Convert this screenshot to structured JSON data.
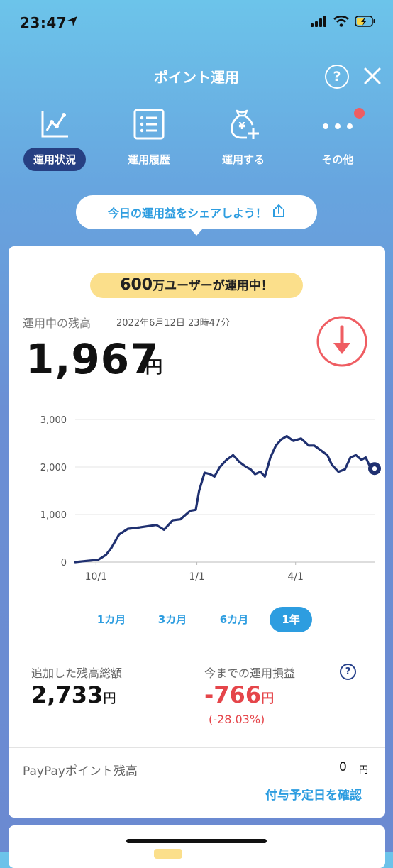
{
  "status_bar": {
    "time": "23:47"
  },
  "header": {
    "title": "ポイント運用",
    "help_label": "?"
  },
  "nav": [
    {
      "label": "運用状況",
      "icon": "line-chart-icon",
      "active": true
    },
    {
      "label": "運用履歴",
      "icon": "list-icon",
      "active": false
    },
    {
      "label": "運用する",
      "icon": "money-bag-add-icon",
      "active": false
    },
    {
      "label": "その他",
      "icon": "more-dots-icon",
      "active": false
    }
  ],
  "share": {
    "text": "今日の運用益をシェアしよう！"
  },
  "card": {
    "badge_number": "600",
    "badge_text": "万ユーザーが運用中！",
    "balance_label": "運用中の残高",
    "balance_datetime": "2022年6月12日 23時47分",
    "balance_amount": "1,967",
    "balance_unit": "円",
    "trend": "down",
    "periods": [
      "1カ月",
      "3カ月",
      "6カ月",
      "1年"
    ],
    "active_period": "1年",
    "added_label": "追加した残高総額",
    "added_value": "2,733",
    "added_unit": "円",
    "pnl_label": "今までの運用損益",
    "pnl_value": "-766",
    "pnl_unit": "円",
    "pnl_percent": "(-28.03%)",
    "help_label": "?",
    "paypay_label": "PayPayポイント残高",
    "paypay_value": "0",
    "paypay_unit": "円",
    "confirm_link": "付与予定日を確認"
  },
  "colors": {
    "accent": "#2d9de0",
    "navy": "#1f3070",
    "loss": "#e5454a",
    "badge": "#fbdf8b"
  },
  "chart_data": {
    "type": "line",
    "ylim": [
      0,
      3000
    ],
    "yticks": [
      0,
      1000,
      2000,
      3000
    ],
    "ytick_labels": [
      "0",
      "1,000",
      "2,000",
      "3,000"
    ],
    "xlim": [
      "2021-09-12",
      "2022-06-12"
    ],
    "xtick_labels": [
      {
        "label": "10/1",
        "date": "2021-10-01"
      },
      {
        "label": "1/1",
        "date": "2022-01-01"
      },
      {
        "label": "4/1",
        "date": "2022-04-01"
      }
    ],
    "grid": true,
    "series": [
      {
        "points": [
          [
            "2021-09-12",
            0
          ],
          [
            "2021-09-20",
            20
          ],
          [
            "2021-10-03",
            50
          ],
          [
            "2021-10-10",
            150
          ],
          [
            "2021-10-15",
            300
          ],
          [
            "2021-10-22",
            580
          ],
          [
            "2021-10-30",
            700
          ],
          [
            "2021-11-10",
            730
          ],
          [
            "2021-11-25",
            780
          ],
          [
            "2021-12-02",
            680
          ],
          [
            "2021-12-10",
            880
          ],
          [
            "2021-12-17",
            900
          ],
          [
            "2021-12-26",
            1080
          ],
          [
            "2021-12-31",
            1100
          ],
          [
            "2022-01-03",
            1500
          ],
          [
            "2022-01-08",
            1880
          ],
          [
            "2022-01-13",
            1850
          ],
          [
            "2022-01-17",
            1800
          ],
          [
            "2022-01-22",
            2000
          ],
          [
            "2022-01-28",
            2150
          ],
          [
            "2022-02-03",
            2250
          ],
          [
            "2022-02-09",
            2100
          ],
          [
            "2022-02-15",
            2000
          ],
          [
            "2022-02-19",
            1950
          ],
          [
            "2022-02-23",
            1850
          ],
          [
            "2022-02-28",
            1900
          ],
          [
            "2022-03-04",
            1800
          ],
          [
            "2022-03-09",
            2200
          ],
          [
            "2022-03-14",
            2450
          ],
          [
            "2022-03-19",
            2580
          ],
          [
            "2022-03-24",
            2650
          ],
          [
            "2022-03-30",
            2550
          ],
          [
            "2022-04-06",
            2600
          ],
          [
            "2022-04-13",
            2450
          ],
          [
            "2022-04-18",
            2450
          ],
          [
            "2022-04-24",
            2350
          ],
          [
            "2022-04-30",
            2250
          ],
          [
            "2022-05-04",
            2050
          ],
          [
            "2022-05-10",
            1900
          ],
          [
            "2022-05-16",
            1950
          ],
          [
            "2022-05-21",
            2200
          ],
          [
            "2022-05-26",
            2250
          ],
          [
            "2022-05-31",
            2150
          ],
          [
            "2022-06-04",
            2200
          ],
          [
            "2022-06-08",
            2000
          ],
          [
            "2022-06-12",
            1967
          ]
        ]
      }
    ]
  }
}
